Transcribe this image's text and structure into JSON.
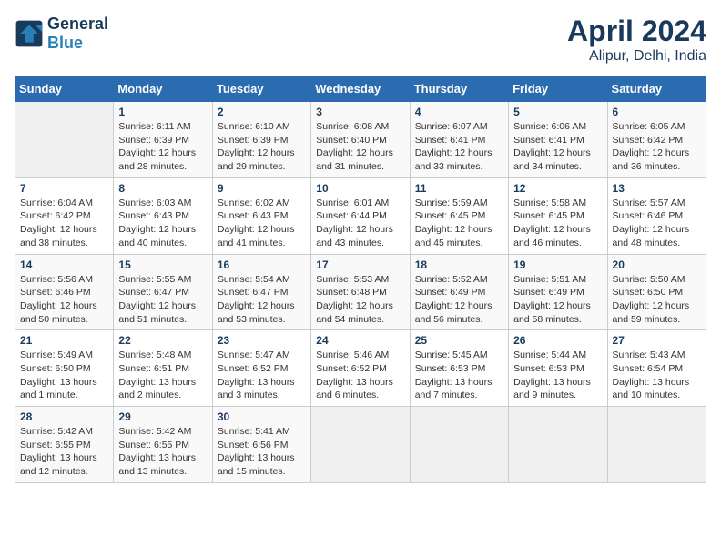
{
  "header": {
    "logo_line1": "General",
    "logo_line2": "Blue",
    "month": "April 2024",
    "location": "Alipur, Delhi, India"
  },
  "weekdays": [
    "Sunday",
    "Monday",
    "Tuesday",
    "Wednesday",
    "Thursday",
    "Friday",
    "Saturday"
  ],
  "weeks": [
    [
      {
        "day": "",
        "info": ""
      },
      {
        "day": "1",
        "info": "Sunrise: 6:11 AM\nSunset: 6:39 PM\nDaylight: 12 hours\nand 28 minutes."
      },
      {
        "day": "2",
        "info": "Sunrise: 6:10 AM\nSunset: 6:39 PM\nDaylight: 12 hours\nand 29 minutes."
      },
      {
        "day": "3",
        "info": "Sunrise: 6:08 AM\nSunset: 6:40 PM\nDaylight: 12 hours\nand 31 minutes."
      },
      {
        "day": "4",
        "info": "Sunrise: 6:07 AM\nSunset: 6:41 PM\nDaylight: 12 hours\nand 33 minutes."
      },
      {
        "day": "5",
        "info": "Sunrise: 6:06 AM\nSunset: 6:41 PM\nDaylight: 12 hours\nand 34 minutes."
      },
      {
        "day": "6",
        "info": "Sunrise: 6:05 AM\nSunset: 6:42 PM\nDaylight: 12 hours\nand 36 minutes."
      }
    ],
    [
      {
        "day": "7",
        "info": "Sunrise: 6:04 AM\nSunset: 6:42 PM\nDaylight: 12 hours\nand 38 minutes."
      },
      {
        "day": "8",
        "info": "Sunrise: 6:03 AM\nSunset: 6:43 PM\nDaylight: 12 hours\nand 40 minutes."
      },
      {
        "day": "9",
        "info": "Sunrise: 6:02 AM\nSunset: 6:43 PM\nDaylight: 12 hours\nand 41 minutes."
      },
      {
        "day": "10",
        "info": "Sunrise: 6:01 AM\nSunset: 6:44 PM\nDaylight: 12 hours\nand 43 minutes."
      },
      {
        "day": "11",
        "info": "Sunrise: 5:59 AM\nSunset: 6:45 PM\nDaylight: 12 hours\nand 45 minutes."
      },
      {
        "day": "12",
        "info": "Sunrise: 5:58 AM\nSunset: 6:45 PM\nDaylight: 12 hours\nand 46 minutes."
      },
      {
        "day": "13",
        "info": "Sunrise: 5:57 AM\nSunset: 6:46 PM\nDaylight: 12 hours\nand 48 minutes."
      }
    ],
    [
      {
        "day": "14",
        "info": "Sunrise: 5:56 AM\nSunset: 6:46 PM\nDaylight: 12 hours\nand 50 minutes."
      },
      {
        "day": "15",
        "info": "Sunrise: 5:55 AM\nSunset: 6:47 PM\nDaylight: 12 hours\nand 51 minutes."
      },
      {
        "day": "16",
        "info": "Sunrise: 5:54 AM\nSunset: 6:47 PM\nDaylight: 12 hours\nand 53 minutes."
      },
      {
        "day": "17",
        "info": "Sunrise: 5:53 AM\nSunset: 6:48 PM\nDaylight: 12 hours\nand 54 minutes."
      },
      {
        "day": "18",
        "info": "Sunrise: 5:52 AM\nSunset: 6:49 PM\nDaylight: 12 hours\nand 56 minutes."
      },
      {
        "day": "19",
        "info": "Sunrise: 5:51 AM\nSunset: 6:49 PM\nDaylight: 12 hours\nand 58 minutes."
      },
      {
        "day": "20",
        "info": "Sunrise: 5:50 AM\nSunset: 6:50 PM\nDaylight: 12 hours\nand 59 minutes."
      }
    ],
    [
      {
        "day": "21",
        "info": "Sunrise: 5:49 AM\nSunset: 6:50 PM\nDaylight: 13 hours\nand 1 minute."
      },
      {
        "day": "22",
        "info": "Sunrise: 5:48 AM\nSunset: 6:51 PM\nDaylight: 13 hours\nand 2 minutes."
      },
      {
        "day": "23",
        "info": "Sunrise: 5:47 AM\nSunset: 6:52 PM\nDaylight: 13 hours\nand 3 minutes."
      },
      {
        "day": "24",
        "info": "Sunrise: 5:46 AM\nSunset: 6:52 PM\nDaylight: 13 hours\nand 6 minutes."
      },
      {
        "day": "25",
        "info": "Sunrise: 5:45 AM\nSunset: 6:53 PM\nDaylight: 13 hours\nand 7 minutes."
      },
      {
        "day": "26",
        "info": "Sunrise: 5:44 AM\nSunset: 6:53 PM\nDaylight: 13 hours\nand 9 minutes."
      },
      {
        "day": "27",
        "info": "Sunrise: 5:43 AM\nSunset: 6:54 PM\nDaylight: 13 hours\nand 10 minutes."
      }
    ],
    [
      {
        "day": "28",
        "info": "Sunrise: 5:42 AM\nSunset: 6:55 PM\nDaylight: 13 hours\nand 12 minutes."
      },
      {
        "day": "29",
        "info": "Sunrise: 5:42 AM\nSunset: 6:55 PM\nDaylight: 13 hours\nand 13 minutes."
      },
      {
        "day": "30",
        "info": "Sunrise: 5:41 AM\nSunset: 6:56 PM\nDaylight: 13 hours\nand 15 minutes."
      },
      {
        "day": "",
        "info": ""
      },
      {
        "day": "",
        "info": ""
      },
      {
        "day": "",
        "info": ""
      },
      {
        "day": "",
        "info": ""
      }
    ]
  ]
}
